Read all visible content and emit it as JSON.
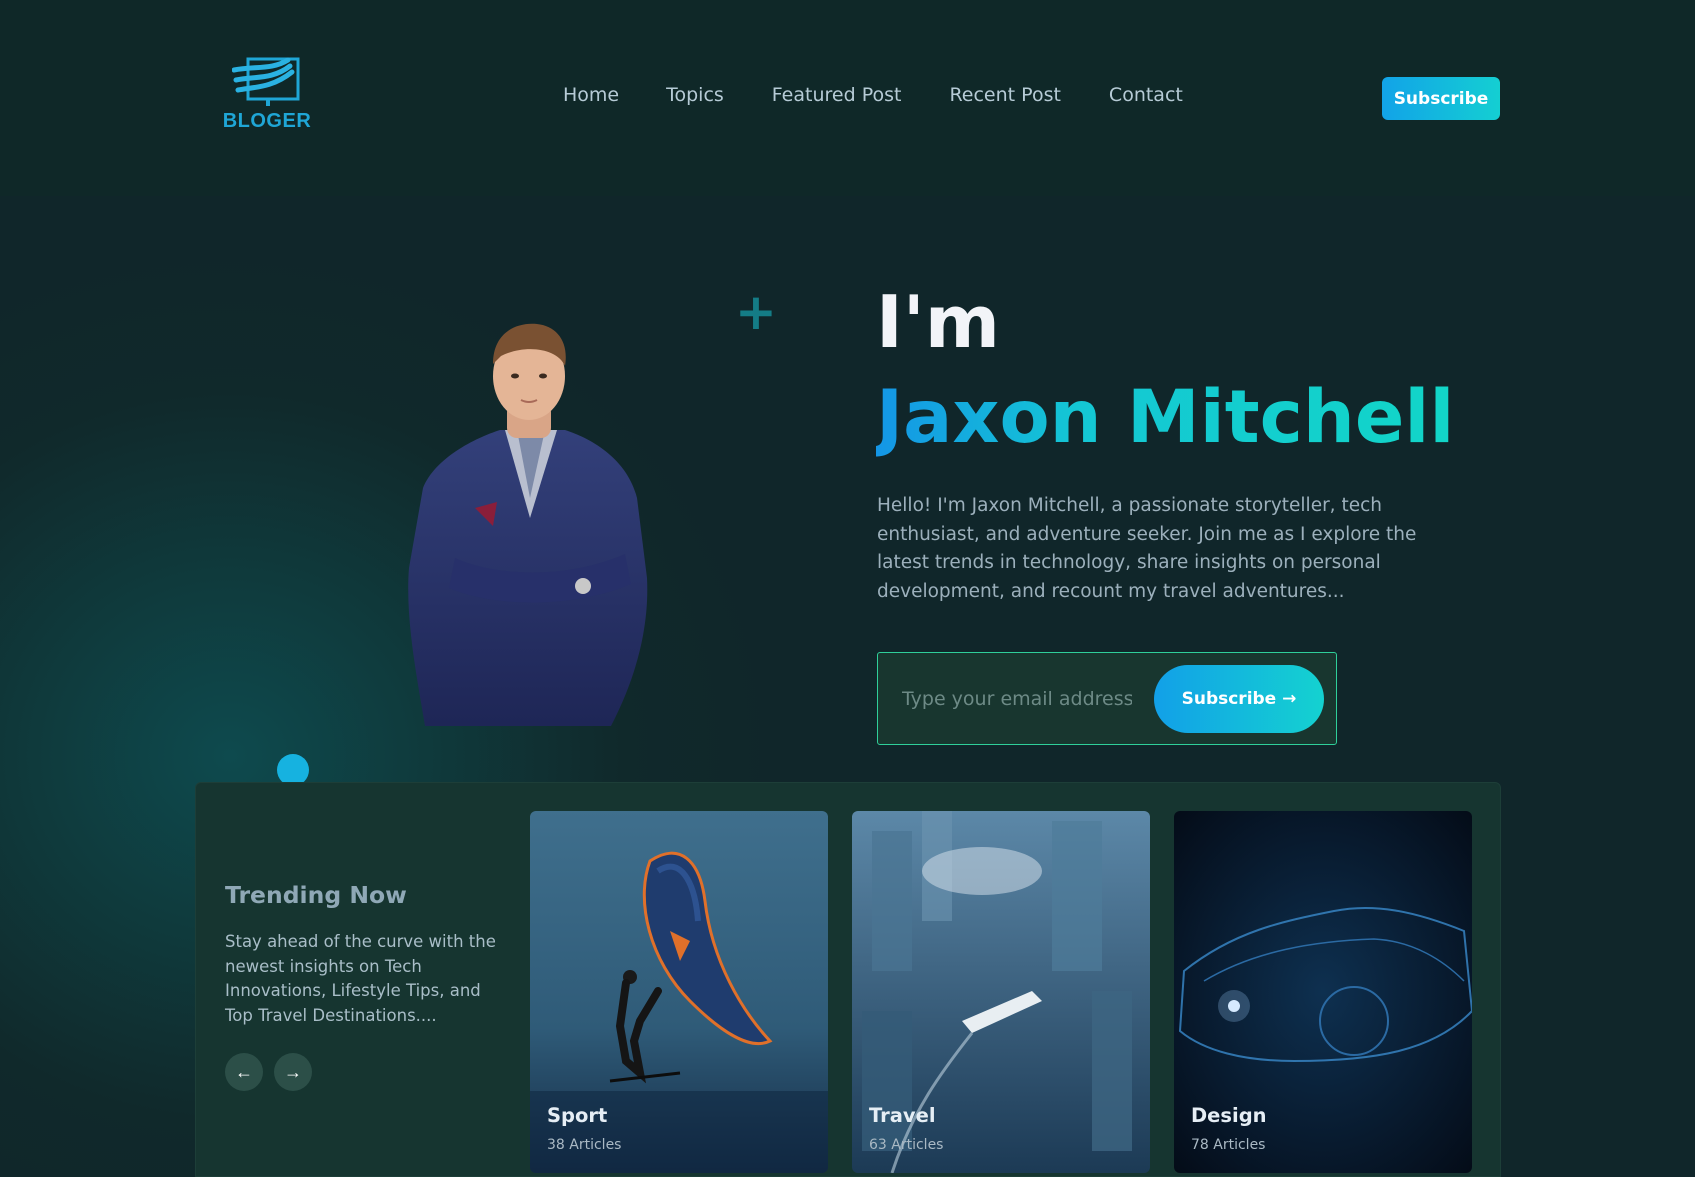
{
  "brand": {
    "name": "BLOGER"
  },
  "nav": {
    "items": [
      "Home",
      "Topics",
      "Featured Post",
      "Recent Post",
      "Contact"
    ]
  },
  "header": {
    "subscribe_label": "Subscribe"
  },
  "hero": {
    "greeting": "I'm",
    "name": "Jaxon Mitchell",
    "bio": "Hello! I'm Jaxon Mitchell, a passionate storyteller, tech enthusiast, and adventure seeker. Join me as I explore the latest trends in technology, share insights on personal development, and recount my travel adventures...",
    "email_placeholder": "Type your email address",
    "subscribe_label": "Subscribe →"
  },
  "trending": {
    "title": "Trending Now",
    "description": "Stay ahead of the curve with the newest insights on Tech Innovations, Lifestyle Tips, and Top Travel Destinations....",
    "cards": [
      {
        "title": "Sport",
        "count": "38 Articles"
      },
      {
        "title": "Travel",
        "count": "63 Articles"
      },
      {
        "title": "Design",
        "count": "78 Articles"
      }
    ]
  },
  "colors": {
    "accent_start": "#12a0e8",
    "accent_end": "#14d2d0",
    "background": "#10262a",
    "panel": "#163530"
  }
}
